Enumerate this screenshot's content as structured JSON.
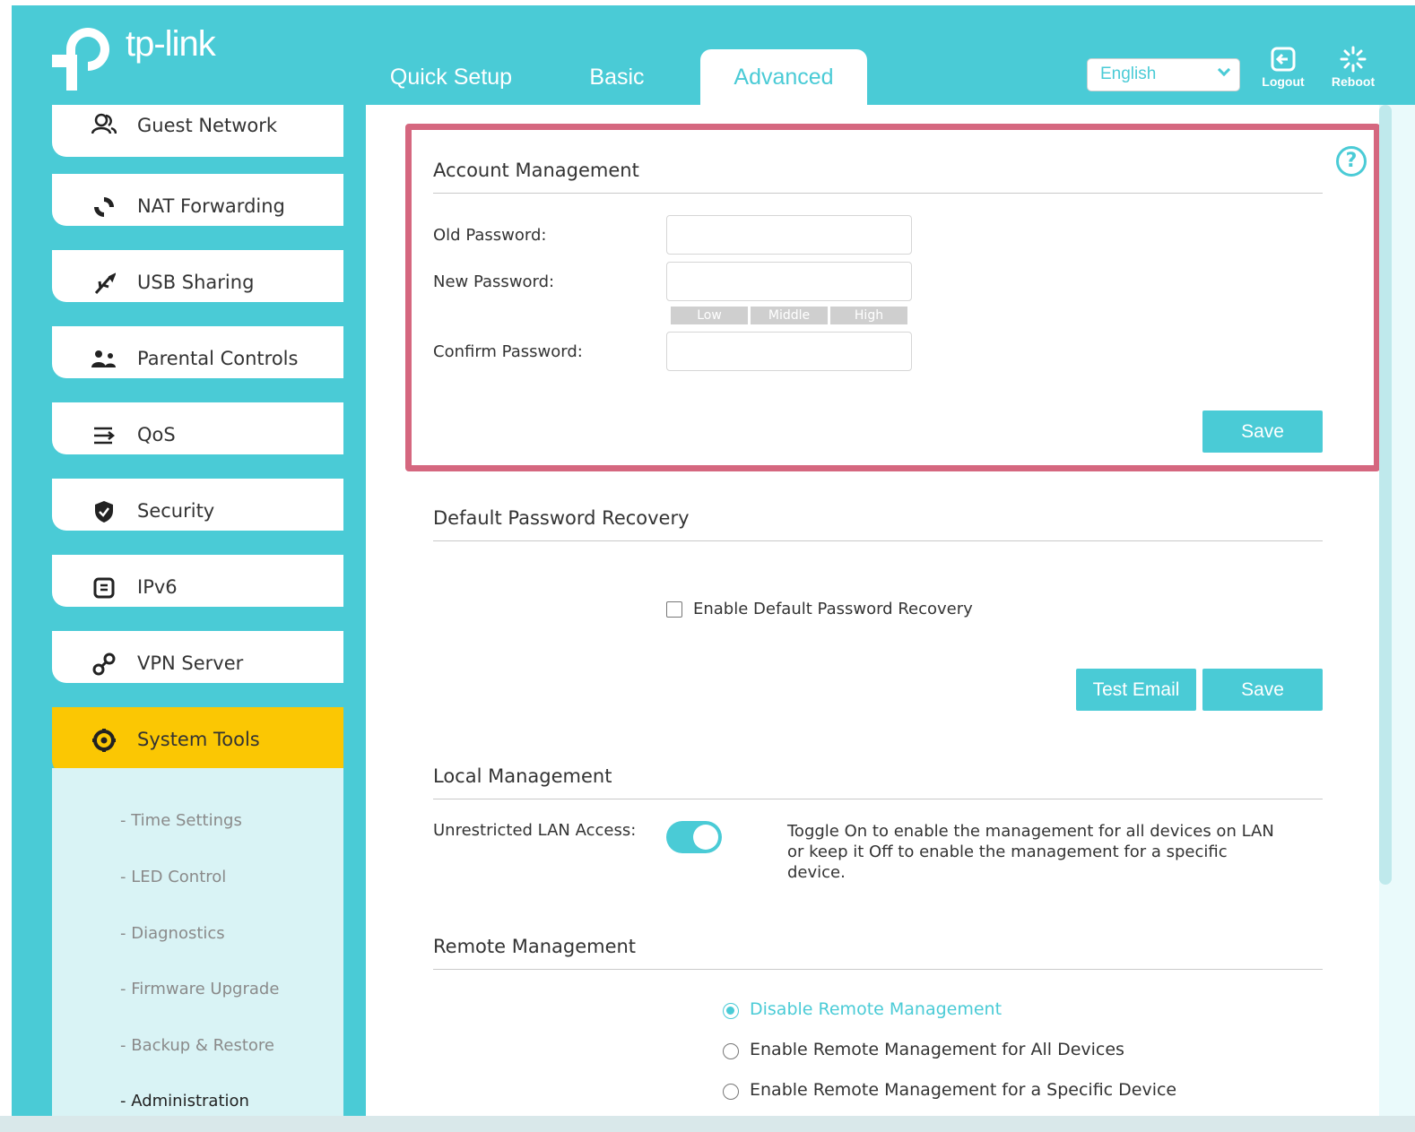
{
  "brand": {
    "name": "tp-link"
  },
  "tabs": [
    {
      "label": "Quick Setup"
    },
    {
      "label": "Basic"
    },
    {
      "label": "Advanced",
      "active": true
    }
  ],
  "language": {
    "selected": "English"
  },
  "header_buttons": {
    "logout": "Logout",
    "reboot": "Reboot"
  },
  "sidebar": {
    "items": [
      {
        "label": "Guest Network",
        "icon": "guest-network-icon"
      },
      {
        "label": "NAT Forwarding",
        "icon": "nat-forwarding-icon"
      },
      {
        "label": "USB Sharing",
        "icon": "usb-icon"
      },
      {
        "label": "Parental Controls",
        "icon": "parental-controls-icon"
      },
      {
        "label": "QoS",
        "icon": "qos-icon"
      },
      {
        "label": "Security",
        "icon": "shield-icon"
      },
      {
        "label": "IPv6",
        "icon": "ipv6-icon"
      },
      {
        "label": "VPN Server",
        "icon": "vpn-link-icon"
      },
      {
        "label": "System Tools",
        "icon": "gear-icon",
        "active": true
      }
    ],
    "submenu": [
      {
        "label": "- Time Settings"
      },
      {
        "label": "- LED Control"
      },
      {
        "label": "- Diagnostics"
      },
      {
        "label": "- Firmware Upgrade"
      },
      {
        "label": "- Backup & Restore"
      },
      {
        "label": "- Administration",
        "current": true
      }
    ]
  },
  "account": {
    "title": "Account Management",
    "old_password_label": "Old Password:",
    "new_password_label": "New Password:",
    "confirm_password_label": "Confirm Password:",
    "old_password_value": "",
    "new_password_value": "",
    "confirm_password_value": "",
    "strength": [
      "Low",
      "Middle",
      "High"
    ],
    "save_label": "Save"
  },
  "recovery": {
    "title": "Default Password Recovery",
    "checkbox_label": "Enable Default Password Recovery",
    "checked": false,
    "test_email_label": "Test Email",
    "save_label": "Save"
  },
  "local": {
    "title": "Local Management",
    "lan_label": "Unrestricted LAN Access:",
    "toggle_on": true,
    "description": "Toggle On to enable the management for all devices on LAN or keep it Off to enable the management for a specific device."
  },
  "remote": {
    "title": "Remote Management",
    "options": [
      {
        "label": "Disable Remote Management",
        "selected": true
      },
      {
        "label": "Enable Remote Management for All Devices",
        "selected": false
      },
      {
        "label": "Enable Remote Management for a Specific Device",
        "selected": false
      }
    ]
  },
  "colors": {
    "accent": "#4acbd6",
    "active_nav": "#fbc703",
    "highlight": "#d5677f"
  }
}
